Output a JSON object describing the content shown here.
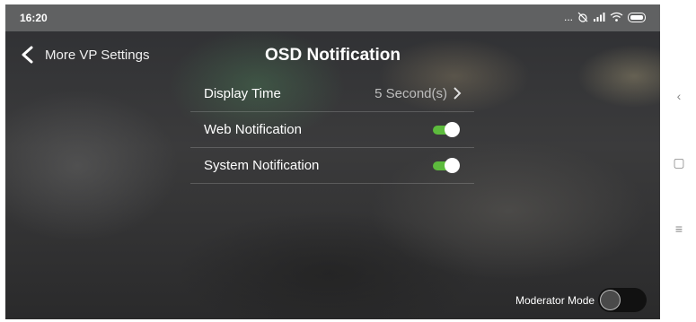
{
  "status_bar": {
    "time": "16:20",
    "dots": "...",
    "icons": [
      "alarm-off-icon",
      "signal-icon",
      "wifi-icon",
      "battery-icon"
    ]
  },
  "header": {
    "back_label": "More VP Settings",
    "title": "OSD Notification"
  },
  "settings": [
    {
      "label": "Display Time",
      "value": "5 Second(s)",
      "type": "link"
    },
    {
      "label": "Web Notification",
      "type": "toggle",
      "on": true
    },
    {
      "label": "System Notification",
      "type": "toggle",
      "on": true
    }
  ],
  "moderator": {
    "label": "Moderator Mode",
    "on": false
  },
  "colors": {
    "toggle_on": "#5dbb3d",
    "status_bar": "#606162"
  },
  "nav": {
    "back_icon": "‹",
    "home_icon": "▢",
    "menu_icon": "≡"
  }
}
